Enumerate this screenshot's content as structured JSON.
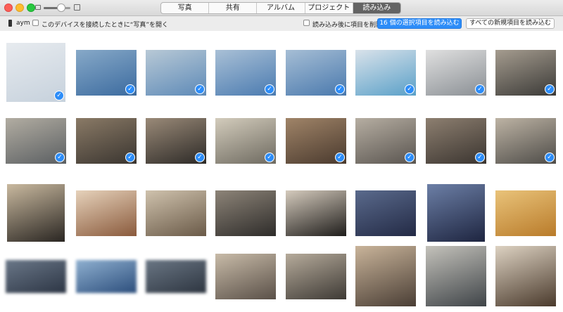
{
  "toolbar": {
    "tabs": [
      {
        "label": "写真",
        "active": false
      },
      {
        "label": "共有",
        "active": false
      },
      {
        "label": "アルバム",
        "active": false
      },
      {
        "label": "プロジェクト",
        "active": false
      },
      {
        "label": "読み込み",
        "active": true
      }
    ],
    "thumbnail_size_level": 0.65
  },
  "import_bar": {
    "device_name": "aym",
    "open_on_connect_label": "このデバイスを接続したときに“写真”を開く",
    "open_on_connect_checked": false,
    "delete_after_import_label": "読み込み後に項目を削除",
    "delete_after_import_checked": false,
    "import_selected_label": "16 個の選択項目を読み込む",
    "import_all_new_label": "すべての新規項目を読み込む"
  },
  "colors": {
    "accent": "#2d8df8",
    "active_tab": "#636363"
  },
  "photos": [
    {
      "name": "photo-seagulls-sky",
      "selected": true,
      "colors": [
        "#c6d1dc",
        "#e7ebef"
      ],
      "blurred": false
    },
    {
      "name": "photo-seagulls-mount-fuji",
      "selected": true,
      "colors": [
        "#3c6b9f",
        "#87a9c8"
      ],
      "blurred": false
    },
    {
      "name": "photo-harbor-island",
      "selected": true,
      "colors": [
        "#5e8ab7",
        "#b8c9d6"
      ],
      "blurred": false
    },
    {
      "name": "photo-seagulls-sea",
      "selected": true,
      "colors": [
        "#4b7bb0",
        "#a9c0d6"
      ],
      "blurred": false
    },
    {
      "name": "photo-seagulls-sea-2",
      "selected": true,
      "colors": [
        "#4a79ad",
        "#a6bed5"
      ],
      "blurred": false
    },
    {
      "name": "photo-phone-over-sea",
      "selected": true,
      "colors": [
        "#5aa0c8",
        "#d9e2ea"
      ],
      "blurred": false
    },
    {
      "name": "photo-phone-in-hand",
      "selected": true,
      "colors": [
        "#8a8f94",
        "#e0e0e0"
      ],
      "blurred": false
    },
    {
      "name": "photo-restaurant-storefront",
      "selected": true,
      "colors": [
        "#3b3a37",
        "#a59c8f"
      ],
      "blurred": false
    },
    {
      "name": "photo-oysters-on-grill",
      "selected": true,
      "colors": [
        "#5b5f62",
        "#b2ada2"
      ],
      "blurred": false
    },
    {
      "name": "photo-friends-at-table",
      "selected": true,
      "colors": [
        "#3a3530",
        "#8a7a66"
      ],
      "blurred": false
    },
    {
      "name": "photo-friends-eating",
      "selected": true,
      "colors": [
        "#2d2a27",
        "#9a8a78"
      ],
      "blurred": false
    },
    {
      "name": "photo-oyster-closeup",
      "selected": true,
      "colors": [
        "#6e6a60",
        "#d3ccbc"
      ],
      "blurred": false
    },
    {
      "name": "photo-people-dining",
      "selected": true,
      "colors": [
        "#4a3a2e",
        "#a08468"
      ],
      "blurred": false
    },
    {
      "name": "photo-person-sleeping",
      "selected": true,
      "colors": [
        "#5a5550",
        "#b6aea2"
      ],
      "blurred": false
    },
    {
      "name": "photo-friends-drinking",
      "selected": true,
      "colors": [
        "#3b3530",
        "#8d7f70"
      ],
      "blurred": false
    },
    {
      "name": "photo-oyster-bowl",
      "selected": true,
      "colors": [
        "#4e4c48",
        "#bdb3a4"
      ],
      "blurred": false
    },
    {
      "name": "photo-rice-with-oysters",
      "selected": false,
      "colors": [
        "#2a2622",
        "#c9b99f"
      ],
      "blurred": false
    },
    {
      "name": "photo-scallop-shell",
      "selected": false,
      "colors": [
        "#8a5a3c",
        "#e6d2bb"
      ],
      "blurred": false
    },
    {
      "name": "photo-grilled-oysters",
      "selected": false,
      "colors": [
        "#6a5a48",
        "#cfc2ad"
      ],
      "blurred": false
    },
    {
      "name": "photo-oyster-pile",
      "selected": false,
      "colors": [
        "#2e2c2a",
        "#8d8478"
      ],
      "blurred": false
    },
    {
      "name": "photo-oyster-on-shell",
      "selected": false,
      "colors": [
        "#1f1d1b",
        "#d5cbbd"
      ],
      "blurred": false
    },
    {
      "name": "photo-dusk-street-lamp",
      "selected": false,
      "colors": [
        "#232a45",
        "#5a6a8c"
      ],
      "blurred": false
    },
    {
      "name": "photo-dusk-mountain-lamp",
      "selected": false,
      "colors": [
        "#1e2540",
        "#6c7fa6"
      ],
      "blurred": false
    },
    {
      "name": "photo-beer-glass",
      "selected": false,
      "colors": [
        "#b97b2a",
        "#e9c37a"
      ],
      "blurred": false
    },
    {
      "name": "photo-blurred-group",
      "selected": false,
      "colors": [
        "#2c3544",
        "#6a7788"
      ],
      "blurred": true
    },
    {
      "name": "photo-blurred-landscape",
      "selected": false,
      "colors": [
        "#2c4e7c",
        "#8fb0d0"
      ],
      "blurred": true
    },
    {
      "name": "photo-blurred-people",
      "selected": false,
      "colors": [
        "#2d3540",
        "#6a7684"
      ],
      "blurred": true
    },
    {
      "name": "photo-oyster-hand",
      "selected": false,
      "colors": [
        "#5a5048",
        "#c8bba8"
      ],
      "blurred": false
    },
    {
      "name": "photo-oyster-tray",
      "selected": false,
      "colors": [
        "#3e3a35",
        "#b6ab9b"
      ],
      "blurred": false
    },
    {
      "name": "photo-person-holding-oyster",
      "selected": false,
      "colors": [
        "#4a3e35",
        "#c9b49a"
      ],
      "blurred": false
    },
    {
      "name": "photo-oyster-plate",
      "selected": false,
      "colors": [
        "#3f4448",
        "#c4c2bb"
      ],
      "blurred": false
    },
    {
      "name": "photo-oysters-with-greens",
      "selected": false,
      "colors": [
        "#4a3a2c",
        "#ddd2c2"
      ],
      "blurred": false
    }
  ]
}
